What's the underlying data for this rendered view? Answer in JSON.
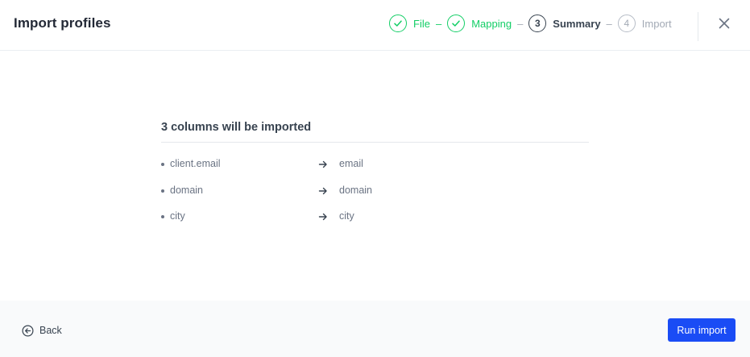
{
  "header": {
    "title": "Import profiles",
    "steps": [
      {
        "label": "File",
        "state": "done"
      },
      {
        "label": "Mapping",
        "state": "done"
      },
      {
        "number": "3",
        "label": "Summary",
        "state": "current"
      },
      {
        "number": "4",
        "label": "Import",
        "state": "future"
      }
    ],
    "separator": "–"
  },
  "summary": {
    "title": "3 columns will be imported",
    "mappings": [
      {
        "source": "client.email",
        "target": "email"
      },
      {
        "source": "domain",
        "target": "domain"
      },
      {
        "source": "city",
        "target": "city"
      }
    ]
  },
  "footer": {
    "back_label": "Back",
    "run_label": "Run import"
  },
  "colors": {
    "accent": "#1a4cf5",
    "success": "#13ce66",
    "text": "#384350",
    "muted": "#a3aab5"
  },
  "icons": {
    "done_step": "check-icon",
    "close": "close-icon",
    "mapping": "arrow-right-icon",
    "back": "arrow-left-circle-icon"
  }
}
